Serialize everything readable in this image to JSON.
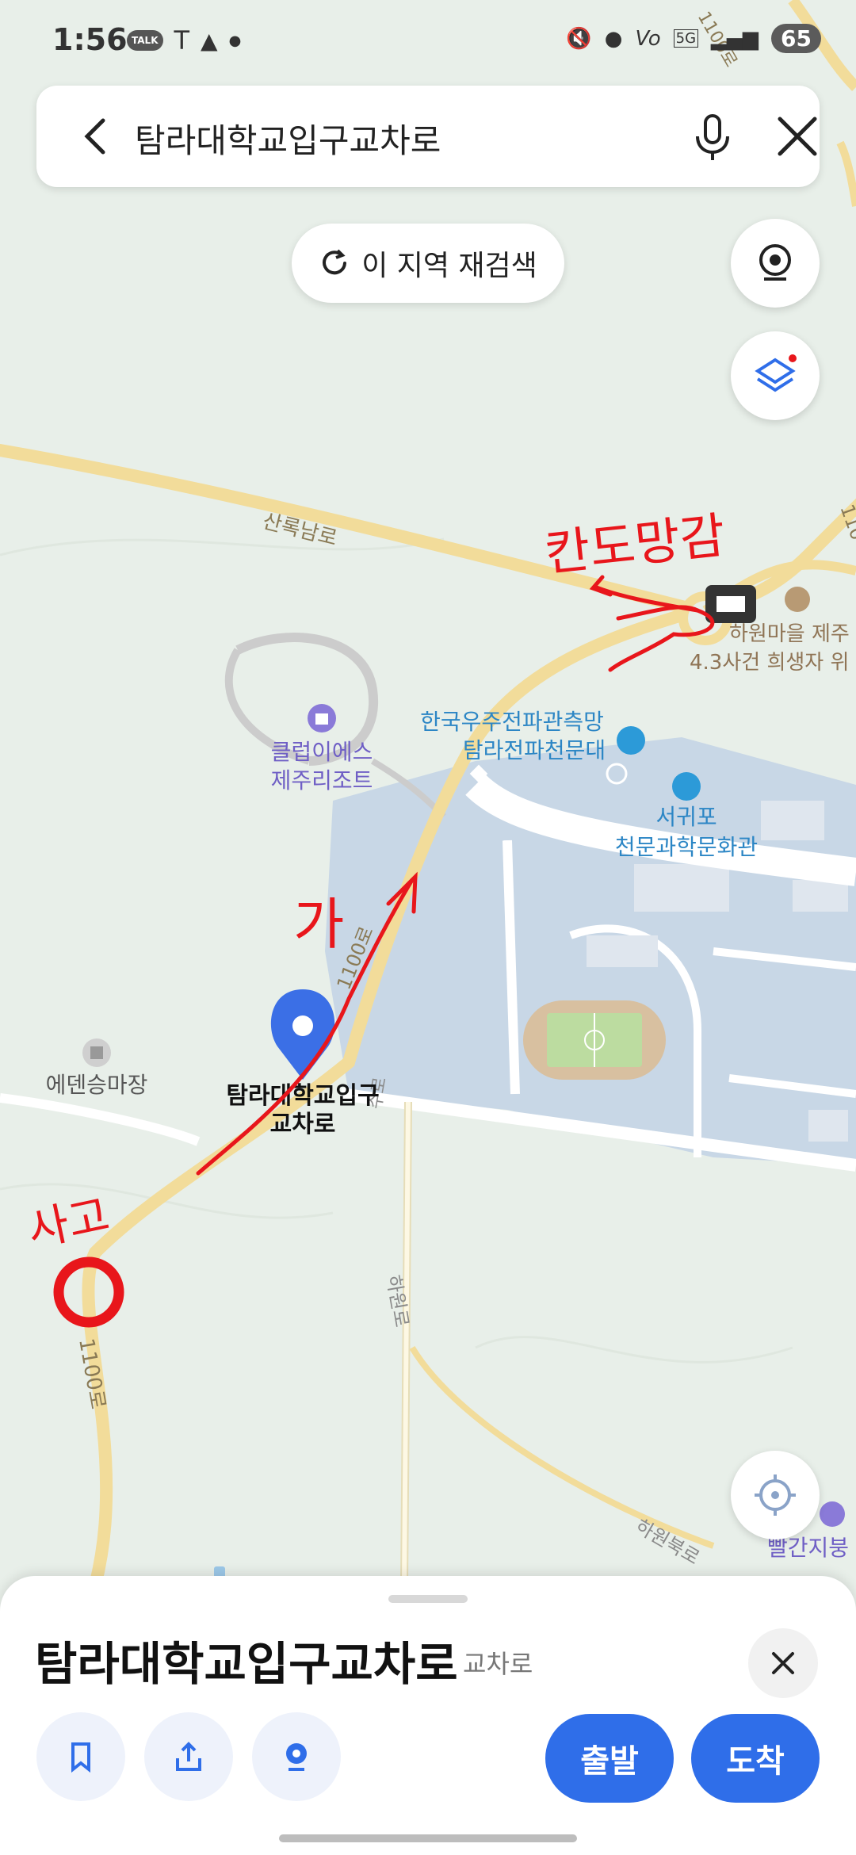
{
  "status_bar": {
    "time": "1:56",
    "talk_badge": "TALK",
    "network": "5G",
    "carrier": "Vo",
    "battery": "65"
  },
  "search": {
    "query": "탐라대학교입구교차로"
  },
  "reload_label": "이 지역 재검색",
  "map": {
    "roads": {
      "sanrok": "산록남로",
      "r1100_a": "1100로",
      "r1100_b": "1100로",
      "hawon_buk": "하원북로",
      "hawon_rd": "하원로",
      "top_road": "1100로",
      "right_road": "110",
      "small_rd": "수로"
    },
    "places": {
      "club": [
        "클럽이에스",
        "제주리조트"
      ],
      "observatory": [
        "한국우주전파관측망",
        "탐라전파천문대"
      ],
      "seogwipo": [
        "서귀포",
        "천문과학문화관"
      ],
      "eden": "에덴승마장",
      "hawon_village": "하원마을 제주",
      "memorial": "4.3사건 희생자 위",
      "red_roof": "빨간지붕"
    },
    "marker": [
      "탐라대학교입구",
      "교차로"
    ],
    "annotations": {
      "accident": "사고",
      "go": "가",
      "wait": "칸도망감"
    }
  },
  "sheet": {
    "title": "탐라대학교입구교차로",
    "category": "교차로",
    "depart": "출발",
    "arrive": "도착"
  },
  "colors": {
    "accent_blue": "#2f6ee9",
    "map_bg": "#e8efe9",
    "road_yellow": "#f2dc9a",
    "campus": "#c9d7e6",
    "annotation_red": "#e8161b"
  }
}
